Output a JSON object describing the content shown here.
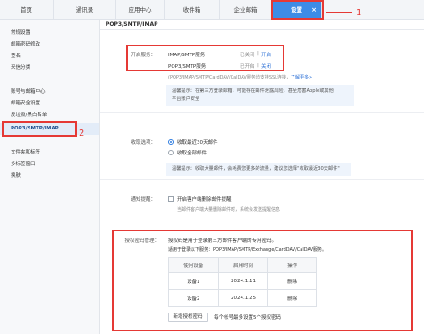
{
  "tabs": [
    {
      "label": "首页"
    },
    {
      "label": "通讯录"
    },
    {
      "label": "应用中心"
    },
    {
      "label": "收件箱"
    },
    {
      "label": "企业邮箱"
    },
    {
      "label": "设置"
    }
  ],
  "active_tab_close": "×",
  "sidebar": {
    "items": [
      {
        "label": "常规设置"
      },
      {
        "label": "邮箱密码修改"
      },
      {
        "label": "签名"
      },
      {
        "label": "来信分类"
      },
      {
        "label": "账号与邮箱中心"
      },
      {
        "label": "邮箱安全设置"
      },
      {
        "label": "反垃圾/黑白名单"
      },
      {
        "label": "POP3/SMTP/IMAP"
      },
      {
        "label": "文件夹和标签"
      },
      {
        "label": "多标签窗口"
      },
      {
        "label": "换肤"
      }
    ]
  },
  "main": {
    "title": "POP3/SMTP/IMAP",
    "service": {
      "label": "开启服务：",
      "rows": [
        {
          "name": "IMAP/SMTP服务",
          "status": "已关闭",
          "sep": "|",
          "action": "开启"
        },
        {
          "name": "POP3/SMTP服务",
          "status": "已开启",
          "sep": "|",
          "action": "关闭"
        }
      ],
      "hint": "(POP3/IMAP/SMTP/CardDAV/CalDAV服务均支持SSL连接，",
      "hint_link": "了解更多",
      "hint_end": ">"
    },
    "tip1": {
      "line1": "温馨提示：在第三方登录邮箱，可能存在邮件泄露风险，甚至危害Apple或其他",
      "line2": "平台账户安全"
    },
    "receive": {
      "label": "收取选项：",
      "options": [
        {
          "label": "收取最近30天邮件",
          "selected": true
        },
        {
          "label": "收取全部邮件",
          "selected": false
        }
      ],
      "tip": "温馨提示：收取大量邮件，会耗费您更多的流量，建议您选择\"收取最近30天邮件\""
    },
    "notify": {
      "label": "通知提醒：",
      "checkbox_label": "开启客户端删除邮件提醒",
      "hint": "当邮件客户端大量删除邮件时，系统会发送提醒信息"
    },
    "auth": {
      "label": "授权密码管理：",
      "desc1": "授权码是用于登录第三方邮件客户端的专用密码。",
      "desc2": "适用于登录以下服务：POP3/IMAP/SMTP/Exchange/CardDAV/CalDAV服务。",
      "headers": [
        "使用设备",
        "启用时间",
        "操作"
      ],
      "rows": [
        {
          "device": "设备1",
          "date": "2024.1.11",
          "action": "删除"
        },
        {
          "device": "设备2",
          "date": "2024.1.25",
          "action": "删除"
        }
      ],
      "new_button": "新增授权密码",
      "limit_note": "每个帐号最多设置5个授权密码"
    }
  },
  "annotations": {
    "one": "1",
    "two": "2"
  },
  "colors": {
    "accent": "#3d8ce6",
    "highlight": "#e53935",
    "link": "#2a6fd6"
  }
}
